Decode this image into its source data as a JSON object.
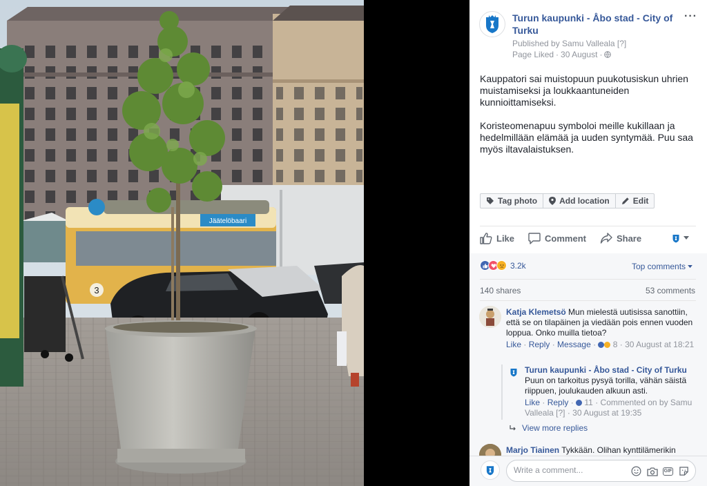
{
  "post": {
    "page_name": "Turun kaupunki - Åbo stad - City of Turku",
    "published_by": "Published by Samu Valleala",
    "help_marker": "[?]",
    "liked_label": "Page Liked",
    "date": "30 August",
    "paragraph1": "Kauppatori sai muistopuun puukotusiskun uhrien muistamiseksi ja loukkaantuneiden kunnioittamiseksi.",
    "paragraph2": "Koristeomenapuu symboloi meille kukillaan ja hedelmillään elämää ja uuden syntymää. Puu saa myös iltavalaistuksen.",
    "more_label": "···"
  },
  "photo_actions": {
    "tag_photo": "Tag photo",
    "add_location": "Add location",
    "edit": "Edit"
  },
  "actions": {
    "like": "Like",
    "comment": "Comment",
    "share": "Share"
  },
  "stats": {
    "reactions_count": "3.2k",
    "top_comments": "Top comments",
    "shares": "140 shares",
    "comments": "53 comments"
  },
  "comments": [
    {
      "author": "Katja Klemetsö",
      "text": "Mun mielestä uutisissa sanottiin, että se on tilapäinen ja viedään pois ennen vuoden loppua. Onko muilla tietoa?",
      "like": "Like",
      "reply": "Reply",
      "message": "Message",
      "reactions": "8",
      "time": "30 August at 18:21"
    },
    {
      "author": "Turun kaupunki - Åbo stad - City of Turku",
      "text": "Puun on tarkoitus pysyä torilla, vähän säistä riippuen, joulukauden alkuun asti.",
      "like": "Like",
      "reply": "Reply",
      "reactions": "11",
      "commented_by": "Commented on by Samu Valleala",
      "help_marker": "[?]",
      "time": "30 August at 19:35"
    },
    {
      "author": "Marjo Tiainen",
      "text": "Tykkään. Olihan kynttilämerikin"
    }
  ],
  "view_more_replies": "View more replies",
  "composer": {
    "placeholder": "Write a comment..."
  },
  "photo": {
    "tram_number": "3",
    "tram_sign": "Jäätelöbaari"
  },
  "colors": {
    "link": "#365899",
    "like_blue": "#4267b2",
    "love_red": "#f25268",
    "sad_yellow": "#f7b125",
    "panel_bg": "#f6f7f9",
    "city_logo": "#1877c8"
  }
}
